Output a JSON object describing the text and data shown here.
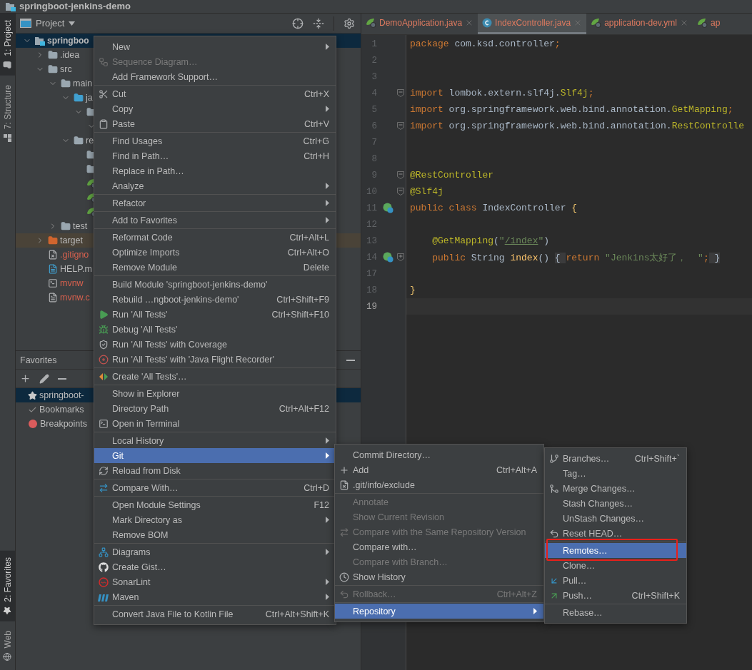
{
  "window": {
    "title": "springboot-jenkins-demo"
  },
  "tool_strip": {
    "top": [
      {
        "label": "1: Project",
        "selected": true
      },
      {
        "label": "7: Structure",
        "selected": false
      }
    ],
    "bottom": [
      {
        "label": "2: Favorites",
        "selected": true
      },
      {
        "label": "Web",
        "selected": false
      }
    ]
  },
  "project_panel": {
    "title": "Project",
    "tree": [
      {
        "label": "springboo",
        "kind": "module",
        "expanded": true,
        "selected": true,
        "unversioned": false,
        "children": [
          {
            "label": ".idea",
            "kind": "folder",
            "expanded": false,
            "selected": false,
            "unversioned": false
          },
          {
            "label": "src",
            "kind": "folder",
            "expanded": true,
            "selected": false,
            "unversioned": false,
            "children": [
              {
                "label": "main",
                "kind": "folder",
                "expanded": true,
                "selected": false,
                "unversioned": false,
                "children": [
                  {
                    "label": "ja",
                    "kind": "source",
                    "expanded": true,
                    "selected": false,
                    "unversioned": false,
                    "children": [
                      {
                        "kind": "package",
                        "expanded": true,
                        "selected": false,
                        "children": [
                          {
                            "expanded": true,
                            "selected": false
                          }
                        ]
                      }
                    ]
                  },
                  {
                    "label": "re",
                    "kind": "resources",
                    "expanded": true,
                    "selected": false,
                    "unversioned": false,
                    "children": [
                      {
                        "kind": "folder",
                        "selected": false
                      },
                      {
                        "kind": "folder",
                        "selected": false
                      },
                      {
                        "kind": "spring-config",
                        "selected": false
                      },
                      {
                        "kind": "spring-config",
                        "selected": false
                      },
                      {
                        "kind": "spring-config",
                        "selected": false
                      }
                    ]
                  }
                ]
              },
              {
                "label": "test",
                "kind": "folder",
                "expanded": false,
                "selected": false,
                "unversioned": false
              }
            ]
          },
          {
            "label": "target",
            "kind": "excluded",
            "expanded": false,
            "selected": false,
            "unversioned": false
          },
          {
            "label": ".gitigno",
            "kind": "file-ignore",
            "selected": false,
            "unversioned": true
          },
          {
            "label": "HELP.m",
            "kind": "file-md",
            "selected": false,
            "unversioned": false
          },
          {
            "label": "mvnw",
            "kind": "file-script",
            "selected": false,
            "unversioned": true
          },
          {
            "label": "mvnw.c",
            "kind": "file-cmd",
            "selected": false,
            "unversioned": true
          }
        ]
      }
    ]
  },
  "favorites_panel": {
    "title": "Favorites",
    "items": [
      {
        "label": "springboot-",
        "kind": "project",
        "selected": true
      },
      {
        "label": "Bookmarks",
        "kind": "bookmarks",
        "selected": false
      },
      {
        "label": "Breakpoints",
        "kind": "breakpoints",
        "selected": false
      }
    ]
  },
  "editor": {
    "tabs": [
      {
        "label": "DemoApplication.java",
        "kind": "spring-run",
        "selected": false,
        "closable": true
      },
      {
        "label": "IndexController.java",
        "kind": "class",
        "selected": true,
        "closable": true
      },
      {
        "label": "application-dev.yml",
        "kind": "spring-config",
        "selected": false,
        "closable": true
      },
      {
        "label": "ap",
        "kind": "spring-config",
        "selected": false,
        "closable": false
      }
    ],
    "lines": [
      {
        "number": "1",
        "bean": false,
        "fold_marker": false,
        "current": false,
        "segments": [
          {
            "kind": "keyword",
            "text": "package"
          },
          {
            "kind": "plain",
            "text": " com.ksd.controller"
          },
          {
            "kind": "keyword",
            "text": ";"
          }
        ]
      },
      {
        "number": "2",
        "bean": false,
        "fold_marker": false,
        "current": false
      },
      {
        "number": "3",
        "bean": false,
        "fold_marker": false,
        "current": false
      },
      {
        "number": "4",
        "bean": false,
        "fold_marker": true,
        "collapsed": false,
        "current": false,
        "segments": [
          {
            "kind": "keyword",
            "text": "import"
          },
          {
            "kind": "plain",
            "text": " lombok.extern.slf4j."
          },
          {
            "kind": "annotation",
            "text": "Slf4j"
          },
          {
            "kind": "keyword",
            "text": ";"
          }
        ]
      },
      {
        "number": "5",
        "bean": false,
        "fold_marker": false,
        "current": false,
        "segments": [
          {
            "kind": "keyword",
            "text": "import"
          },
          {
            "kind": "plain",
            "text": " org.springframework.web.bind.annotation."
          },
          {
            "kind": "annotation",
            "text": "GetMapping"
          },
          {
            "kind": "keyword",
            "text": ";"
          }
        ]
      },
      {
        "number": "6",
        "bean": false,
        "fold_marker": true,
        "collapsed": false,
        "current": false,
        "segments": [
          {
            "kind": "keyword",
            "text": "import"
          },
          {
            "kind": "plain",
            "text": " org.springframework.web.bind.annotation."
          },
          {
            "kind": "annotation",
            "text": "RestControlle"
          }
        ]
      },
      {
        "number": "7",
        "bean": false,
        "fold_marker": false,
        "current": false
      },
      {
        "number": "8",
        "bean": false,
        "fold_marker": false,
        "current": false
      },
      {
        "number": "9",
        "bean": false,
        "fold_marker": true,
        "collapsed": false,
        "current": false,
        "segments": [
          {
            "kind": "annotation",
            "text": "@RestController"
          }
        ]
      },
      {
        "number": "10",
        "bean": false,
        "fold_marker": true,
        "collapsed": false,
        "current": false,
        "segments": [
          {
            "kind": "annotation",
            "text": "@Slf4j"
          }
        ]
      },
      {
        "number": "11",
        "bean": true,
        "fold_marker": false,
        "current": false,
        "segments": [
          {
            "kind": "keyword",
            "text": "public class"
          },
          {
            "kind": "plain",
            "text": " IndexController "
          },
          {
            "kind": "brace",
            "text": "{"
          }
        ]
      },
      {
        "number": "12",
        "bean": false,
        "fold_marker": false,
        "current": false
      },
      {
        "number": "13",
        "bean": false,
        "fold_marker": false,
        "current": false,
        "segments": [
          {
            "kind": "annotation",
            "text": "    @GetMapping"
          },
          {
            "kind": "plain",
            "text": "("
          },
          {
            "kind": "string",
            "text": "\""
          },
          {
            "kind": "link",
            "text": "/index"
          },
          {
            "kind": "string",
            "text": "\""
          },
          {
            "kind": "plain",
            "text": ")"
          }
        ]
      },
      {
        "number": "14",
        "bean": true,
        "fold_marker": true,
        "collapsed": true,
        "current": false,
        "segments": [
          {
            "kind": "keyword",
            "text": "    public"
          },
          {
            "kind": "plain",
            "text": " String "
          },
          {
            "kind": "method",
            "text": "index"
          },
          {
            "kind": "plain",
            "text": "() "
          },
          {
            "kind": "folded",
            "text": "{ "
          },
          {
            "kind": "keyword",
            "text": "return "
          },
          {
            "kind": "string",
            "text": "\"Jenkins太好了，  \""
          },
          {
            "kind": "keyword",
            "text": ";"
          },
          {
            "kind": "folded",
            "text": " }"
          }
        ]
      },
      {
        "number": "17",
        "bean": false,
        "fold_marker": false,
        "current": false
      },
      {
        "number": "18",
        "bean": false,
        "fold_marker": false,
        "current": false,
        "segments": [
          {
            "kind": "brace",
            "text": "}"
          }
        ]
      },
      {
        "number": "19",
        "bean": false,
        "fold_marker": false,
        "current": true
      }
    ]
  },
  "context_menu": {
    "items": [
      {
        "kind": "item",
        "label": "New",
        "submenu": true,
        "disabled": false,
        "selected": false
      },
      {
        "kind": "item",
        "label": "Sequence Diagram…",
        "submenu": false,
        "disabled": true,
        "selected": false
      },
      {
        "kind": "item",
        "label": "Add Framework Support…",
        "submenu": false,
        "disabled": false,
        "selected": false
      },
      {
        "kind": "separator"
      },
      {
        "kind": "item",
        "label": "Cut",
        "shortcut": "Ctrl+X",
        "submenu": false,
        "disabled": false,
        "selected": false
      },
      {
        "kind": "item",
        "label": "Copy",
        "submenu": true,
        "disabled": false,
        "selected": false
      },
      {
        "kind": "item",
        "label": "Paste",
        "shortcut": "Ctrl+V",
        "submenu": false,
        "disabled": false,
        "selected": false
      },
      {
        "kind": "separator"
      },
      {
        "kind": "item",
        "label": "Find Usages",
        "shortcut": "Ctrl+G",
        "submenu": false,
        "disabled": false,
        "selected": false
      },
      {
        "kind": "item",
        "label": "Find in Path…",
        "shortcut": "Ctrl+H",
        "submenu": false,
        "disabled": false,
        "selected": false
      },
      {
        "kind": "item",
        "label": "Replace in Path…",
        "submenu": false,
        "disabled": false,
        "selected": false
      },
      {
        "kind": "item",
        "label": "Analyze",
        "submenu": true,
        "disabled": false,
        "selected": false
      },
      {
        "kind": "separator"
      },
      {
        "kind": "item",
        "label": "Refactor",
        "submenu": true,
        "disabled": false,
        "selected": false
      },
      {
        "kind": "separator"
      },
      {
        "kind": "item",
        "label": "Add to Favorites",
        "submenu": true,
        "disabled": false,
        "selected": false
      },
      {
        "kind": "separator"
      },
      {
        "kind": "item",
        "label": "Reformat Code",
        "shortcut": "Ctrl+Alt+L",
        "submenu": false,
        "disabled": false,
        "selected": false
      },
      {
        "kind": "item",
        "label": "Optimize Imports",
        "shortcut": "Ctrl+Alt+O",
        "submenu": false,
        "disabled": false,
        "selected": false
      },
      {
        "kind": "item",
        "label": "Remove Module",
        "shortcut": "Delete",
        "submenu": false,
        "disabled": false,
        "selected": false
      },
      {
        "kind": "separator"
      },
      {
        "kind": "item",
        "label": "Build Module 'springboot-jenkins-demo'",
        "submenu": false,
        "disabled": false,
        "selected": false
      },
      {
        "kind": "item",
        "label": "Rebuild …ngboot-jenkins-demo'",
        "shortcut": "Ctrl+Shift+F9",
        "submenu": false,
        "disabled": false,
        "selected": false
      },
      {
        "kind": "item",
        "label": "Run 'All Tests'",
        "shortcut": "Ctrl+Shift+F10",
        "submenu": false,
        "disabled": false,
        "selected": false
      },
      {
        "kind": "item",
        "label": "Debug 'All Tests'",
        "submenu": false,
        "disabled": false,
        "selected": false
      },
      {
        "kind": "item",
        "label": "Run 'All Tests' with Coverage",
        "submenu": false,
        "disabled": false,
        "selected": false
      },
      {
        "kind": "item",
        "label": "Run 'All Tests' with 'Java Flight Recorder'",
        "submenu": false,
        "disabled": false,
        "selected": false
      },
      {
        "kind": "separator"
      },
      {
        "kind": "item",
        "label": "Create 'All Tests'…",
        "submenu": false,
        "disabled": false,
        "selected": false
      },
      {
        "kind": "separator"
      },
      {
        "kind": "item",
        "label": "Show in Explorer",
        "submenu": false,
        "disabled": false,
        "selected": false
      },
      {
        "kind": "item",
        "label": "Directory Path",
        "shortcut": "Ctrl+Alt+F12",
        "submenu": false,
        "disabled": false,
        "selected": false
      },
      {
        "kind": "item",
        "label": "Open in Terminal",
        "submenu": false,
        "disabled": false,
        "selected": false
      },
      {
        "kind": "separator"
      },
      {
        "kind": "item",
        "label": "Local History",
        "submenu": true,
        "disabled": false,
        "selected": false
      },
      {
        "kind": "item",
        "label": "Git",
        "submenu": true,
        "disabled": false,
        "selected": true
      },
      {
        "kind": "item",
        "label": "Reload from Disk",
        "submenu": false,
        "disabled": false,
        "selected": false
      },
      {
        "kind": "separator"
      },
      {
        "kind": "item",
        "label": "Compare With…",
        "shortcut": "Ctrl+D",
        "submenu": false,
        "disabled": false,
        "selected": false
      },
      {
        "kind": "separator"
      },
      {
        "kind": "item",
        "label": "Open Module Settings",
        "shortcut": "F12",
        "submenu": false,
        "disabled": false,
        "selected": false
      },
      {
        "kind": "item",
        "label": "Mark Directory as",
        "submenu": true,
        "disabled": false,
        "selected": false
      },
      {
        "kind": "item",
        "label": "Remove BOM",
        "submenu": false,
        "disabled": false,
        "selected": false
      },
      {
        "kind": "separator"
      },
      {
        "kind": "item",
        "label": "Diagrams",
        "submenu": true,
        "disabled": false,
        "selected": false
      },
      {
        "kind": "item",
        "label": "Create Gist…",
        "submenu": false,
        "disabled": false,
        "selected": false
      },
      {
        "kind": "item",
        "label": "SonarLint",
        "submenu": true,
        "disabled": false,
        "selected": false
      },
      {
        "kind": "item",
        "label": "Maven",
        "submenu": true,
        "disabled": false,
        "selected": false
      },
      {
        "kind": "separator"
      },
      {
        "kind": "item",
        "label": "Convert Java File to Kotlin File",
        "shortcut": "Ctrl+Alt+Shift+K",
        "submenu": false,
        "disabled": false,
        "selected": false
      }
    ]
  },
  "git_menu": {
    "items": [
      {
        "kind": "item",
        "label": "Commit Directory…",
        "submenu": false,
        "disabled": false,
        "selected": false
      },
      {
        "kind": "item",
        "label": "Add",
        "shortcut": "Ctrl+Alt+A",
        "submenu": false,
        "disabled": false,
        "selected": false
      },
      {
        "kind": "item",
        "label": ".git/info/exclude",
        "submenu": false,
        "disabled": false,
        "selected": false
      },
      {
        "kind": "separator"
      },
      {
        "kind": "item",
        "label": "Annotate",
        "submenu": false,
        "disabled": true,
        "selected": false
      },
      {
        "kind": "item",
        "label": "Show Current Revision",
        "submenu": false,
        "disabled": true,
        "selected": false
      },
      {
        "kind": "item",
        "label": "Compare with the Same Repository Version",
        "submenu": false,
        "disabled": true,
        "selected": false
      },
      {
        "kind": "item",
        "label": "Compare with…",
        "submenu": false,
        "disabled": false,
        "selected": false
      },
      {
        "kind": "item",
        "label": "Compare with Branch…",
        "submenu": false,
        "disabled": true,
        "selected": false
      },
      {
        "kind": "item",
        "label": "Show History",
        "submenu": false,
        "disabled": false,
        "selected": false
      },
      {
        "kind": "separator"
      },
      {
        "kind": "item",
        "label": "Rollback…",
        "shortcut": "Ctrl+Alt+Z",
        "submenu": false,
        "disabled": true,
        "selected": false
      },
      {
        "kind": "separator"
      },
      {
        "kind": "item",
        "label": "Repository",
        "submenu": true,
        "disabled": false,
        "selected": true
      }
    ]
  },
  "repository_menu": {
    "items": [
      {
        "kind": "item",
        "label": "Branches…",
        "shortcut": "Ctrl+Shift+`",
        "submenu": false,
        "disabled": false,
        "selected": false,
        "outlined": false
      },
      {
        "kind": "item",
        "label": "Tag…",
        "submenu": false,
        "disabled": false,
        "selected": false,
        "outlined": false
      },
      {
        "kind": "item",
        "label": "Merge Changes…",
        "submenu": false,
        "disabled": false,
        "selected": false,
        "outlined": false
      },
      {
        "kind": "item",
        "label": "Stash Changes…",
        "submenu": false,
        "disabled": false,
        "selected": false,
        "outlined": false
      },
      {
        "kind": "item",
        "label": "UnStash Changes…",
        "submenu": false,
        "disabled": false,
        "selected": false,
        "outlined": false
      },
      {
        "kind": "item",
        "label": "Reset HEAD…",
        "submenu": false,
        "disabled": false,
        "selected": false,
        "outlined": false
      },
      {
        "kind": "separator"
      },
      {
        "kind": "item",
        "label": "Remotes…",
        "submenu": false,
        "disabled": false,
        "selected": true,
        "outlined": true
      },
      {
        "kind": "item",
        "label": "Clone…",
        "submenu": false,
        "disabled": false,
        "selected": false,
        "outlined": false
      },
      {
        "kind": "item",
        "label": "Pull…",
        "submenu": false,
        "disabled": false,
        "selected": false,
        "outlined": false
      },
      {
        "kind": "item",
        "label": "Push…",
        "shortcut": "Ctrl+Shift+K",
        "submenu": false,
        "disabled": false,
        "selected": false,
        "outlined": false
      },
      {
        "kind": "separator"
      },
      {
        "kind": "item",
        "label": "Rebase…",
        "submenu": false,
        "disabled": false,
        "selected": false,
        "outlined": false
      }
    ]
  }
}
